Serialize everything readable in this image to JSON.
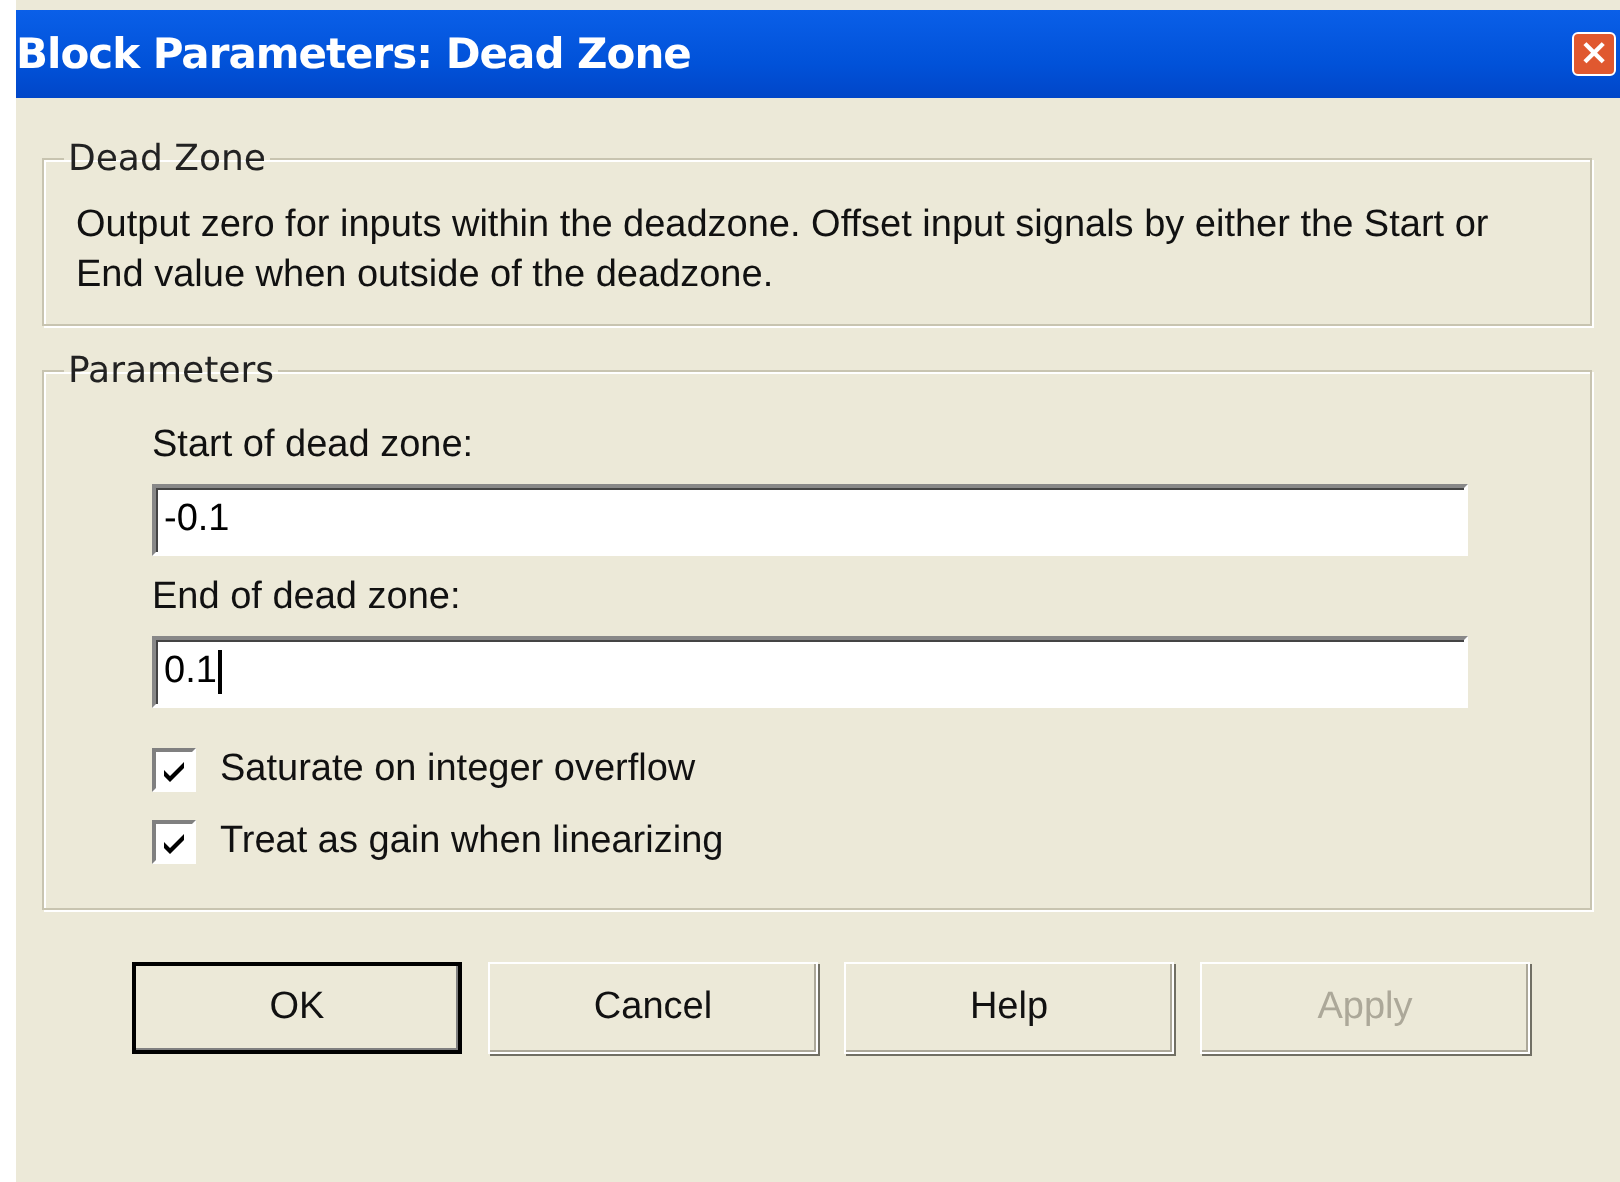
{
  "window": {
    "title": "Block Parameters: Dead Zone",
    "close": "×"
  },
  "description_group": {
    "legend": "Dead Zone",
    "text": "Output zero for inputs within the deadzone.  Offset input signals by either the Start or End value when outside of the deadzone."
  },
  "parameters_group": {
    "legend": "Parameters",
    "fields": [
      {
        "label": "Start of dead zone:",
        "value": "-0.1",
        "focused": false
      },
      {
        "label": "End of dead zone:",
        "value": "0.1",
        "focused": true
      }
    ],
    "checkboxes": [
      {
        "label": "Saturate on integer overflow",
        "checked": true
      },
      {
        "label": "Treat as gain when linearizing",
        "checked": true
      }
    ]
  },
  "buttons": [
    {
      "label": "OK",
      "default": true,
      "disabled": false
    },
    {
      "label": "Cancel",
      "default": false,
      "disabled": false
    },
    {
      "label": "Help",
      "default": false,
      "disabled": false
    },
    {
      "label": "Apply",
      "default": false,
      "disabled": true
    }
  ]
}
